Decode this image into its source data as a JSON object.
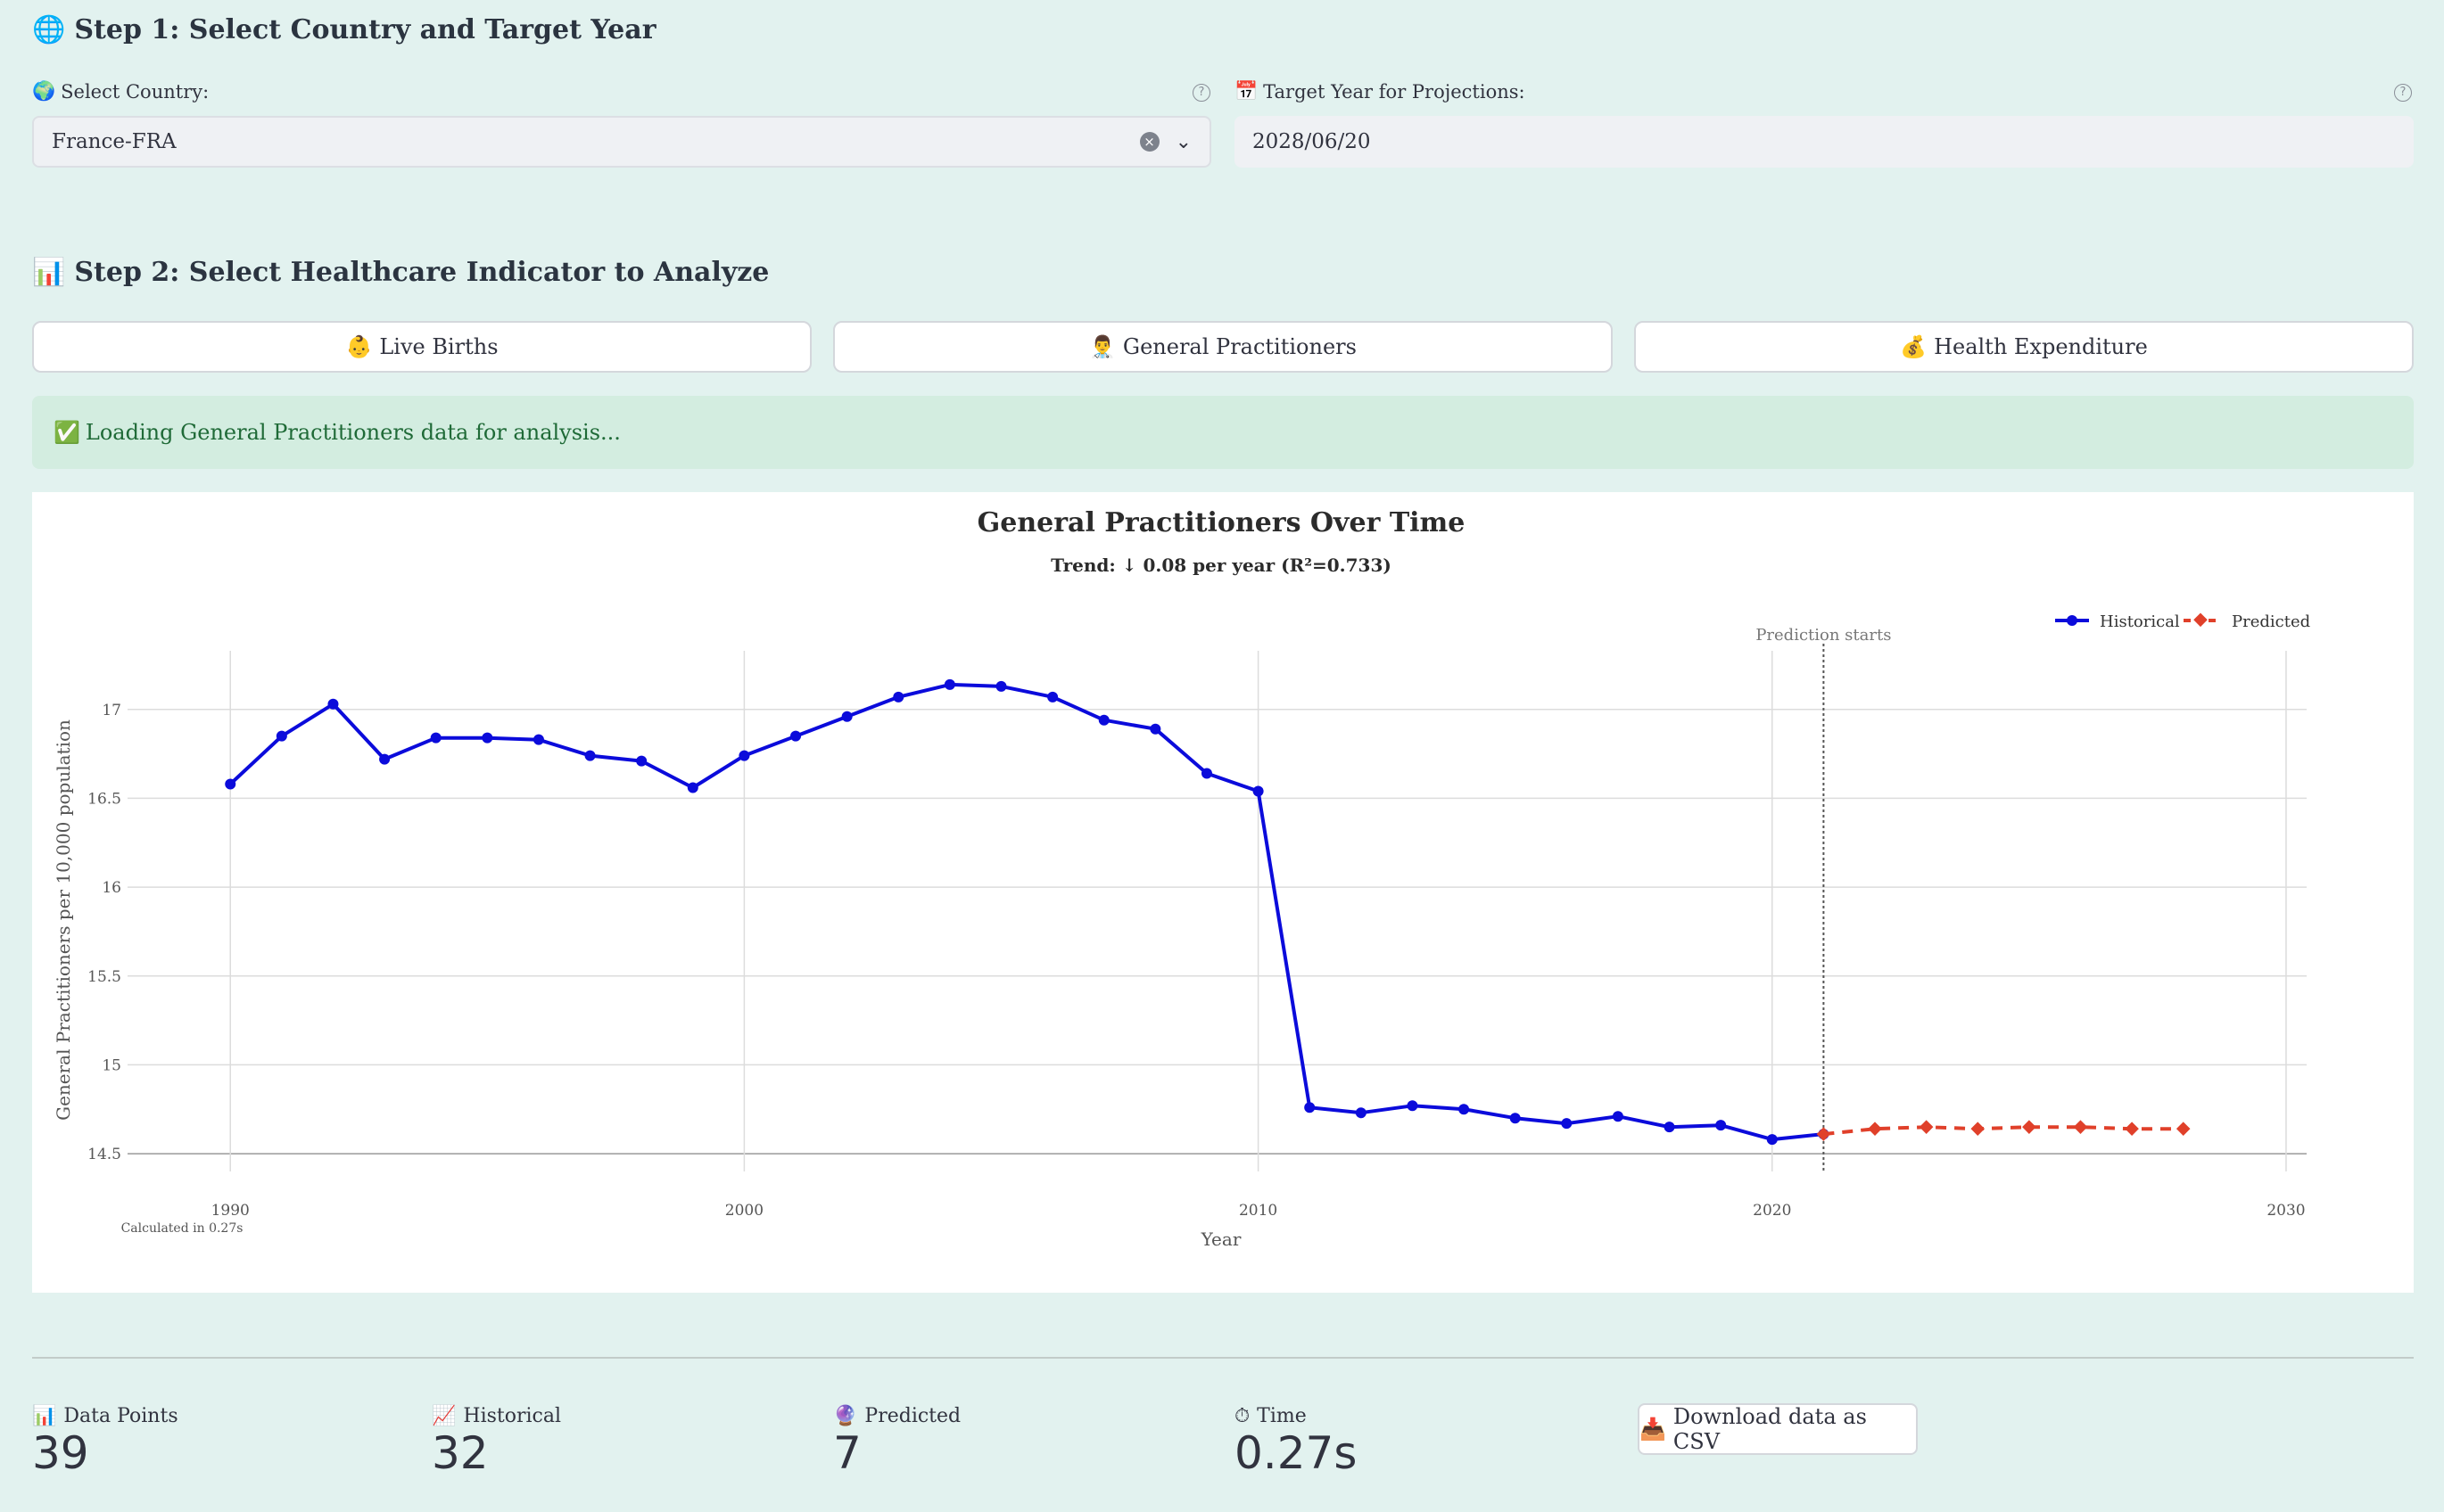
{
  "step1": {
    "icon": "🌐",
    "title": "Step 1: Select Country and Target Year",
    "country_icon": "🌍",
    "country_label": "Select Country:",
    "country_value": "France-FRA",
    "year_icon": "📅",
    "year_label": "Target Year for Projections:",
    "year_value": "2028/06/20"
  },
  "step2": {
    "icon": "📊",
    "title": "Step 2: Select Healthcare Indicator to Analyze",
    "buttons": [
      {
        "icon": "👶",
        "label": "Live Births"
      },
      {
        "icon": "👨‍⚕️",
        "label": "General Practitioners"
      },
      {
        "icon": "💰",
        "label": "Health Expenditure"
      }
    ]
  },
  "banner": {
    "icon": "✅",
    "text": "Loading General Practitioners data for analysis..."
  },
  "chart_data": {
    "type": "line",
    "title": "General Practitioners Over Time",
    "subtitle": "Trend: ↓ 0.08 per year (R²=0.733)",
    "xlabel": "Year",
    "ylabel": "General Practitioners per 10,000 population",
    "xlim": [
      1988,
      2030.4
    ],
    "ylim": [
      14.4,
      17.33
    ],
    "x_ticks": [
      1990,
      2000,
      2010,
      2020,
      2030
    ],
    "y_ticks": [
      14.5,
      15,
      15.5,
      16,
      16.5,
      17
    ],
    "y_tick_labels": [
      "14.5",
      "15",
      "15.5",
      "16",
      "16.5",
      "17"
    ],
    "grid": true,
    "legend_position": "top-right",
    "annotations": {
      "prediction_start_year": 2021,
      "prediction_label": "Prediction starts",
      "calc_note": "Calculated in 0.27s"
    },
    "series": [
      {
        "name": "Historical",
        "color": "#0b0bdb",
        "style": "solid",
        "marker": "circle",
        "x": [
          1990,
          1991,
          1992,
          1993,
          1994,
          1995,
          1996,
          1997,
          1998,
          1999,
          2000,
          2001,
          2002,
          2003,
          2004,
          2005,
          2006,
          2007,
          2008,
          2009,
          2010,
          2011,
          2012,
          2013,
          2014,
          2015,
          2016,
          2017,
          2018,
          2019,
          2020,
          2021
        ],
        "values": [
          16.58,
          16.85,
          17.03,
          16.72,
          16.84,
          16.84,
          16.83,
          16.74,
          16.71,
          16.56,
          16.74,
          16.85,
          16.96,
          17.07,
          17.14,
          17.13,
          17.07,
          16.94,
          16.89,
          16.64,
          16.54,
          14.76,
          14.73,
          14.77,
          14.75,
          14.7,
          14.67,
          14.71,
          14.65,
          14.66,
          14.58,
          14.61
        ]
      },
      {
        "name": "Predicted",
        "color": "#e0402a",
        "style": "dashed",
        "marker": "diamond",
        "x": [
          2021,
          2022,
          2023,
          2024,
          2025,
          2026,
          2027,
          2028
        ],
        "values": [
          14.61,
          14.64,
          14.65,
          14.64,
          14.65,
          14.65,
          14.64,
          14.64
        ]
      }
    ]
  },
  "metrics": [
    {
      "icon": "📊",
      "label": "Data Points",
      "value": "39"
    },
    {
      "icon": "📈",
      "label": "Historical",
      "value": "32"
    },
    {
      "icon": "🔮",
      "label": "Predicted",
      "value": "7"
    },
    {
      "icon": "⏱",
      "label": "Time",
      "value": "0.27s"
    }
  ],
  "download": {
    "icon": "📥",
    "label": "Download data as CSV"
  }
}
